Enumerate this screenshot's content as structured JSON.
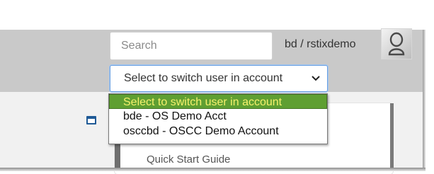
{
  "header": {
    "search": {
      "placeholder": "Search",
      "value": ""
    },
    "user_label": "bd / rstixdemo",
    "avatar_icon": "user-avatar-icon"
  },
  "account_switcher": {
    "selected": "Select to switch user in account",
    "options": [
      "Select to switch user in account",
      "bde - OS Demo Acct",
      "osccbd - OSCC Demo Account"
    ],
    "highlight_color": "#5f9f32",
    "highlight_text_color": "#f6f16c"
  },
  "main": {
    "quick_start_label": "Quick Start Guide",
    "window_icon": "window-icon",
    "accent_color": "#1f5a96"
  }
}
